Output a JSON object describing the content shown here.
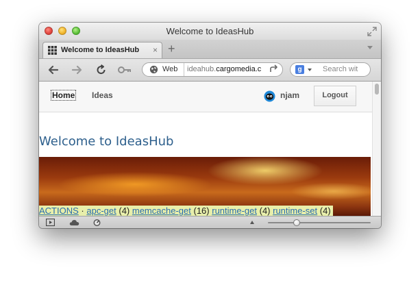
{
  "window": {
    "title": "Welcome to IdeasHub"
  },
  "tab": {
    "label": "Welcome to IdeasHub",
    "close_glyph": "×",
    "new_tab_glyph": "+"
  },
  "toolbar": {
    "back_icon": "back-arrow-icon",
    "forward_icon": "forward-arrow-icon",
    "reload_icon": "reload-icon",
    "key_icon": "key-icon"
  },
  "address": {
    "mode_label": "Web",
    "url_prefix": "ideahub.",
    "url_domain": "cargomedia.c"
  },
  "search": {
    "engine": "g",
    "placeholder": "Search wit"
  },
  "page": {
    "nav": {
      "home": "Home",
      "ideas": "Ideas",
      "username": "njam",
      "logout": "Logout"
    },
    "title": "Welcome to IdeasHub",
    "debug": {
      "actions_label": "ACTIONS",
      "separator": " · ",
      "items": [
        {
          "name": "apc-get",
          "count": "(4)"
        },
        {
          "name": "memcache-get",
          "count": "(16)"
        },
        {
          "name": "runtime-get",
          "count": "(4)"
        },
        {
          "name": "runtime-set",
          "count": "(4)"
        }
      ]
    }
  },
  "statusbar": {
    "zoom_level": 0.28
  },
  "colors": {
    "title_blue": "#2d5f8c",
    "link_blue": "#2a6db0",
    "debug_bg": "#eefab4"
  }
}
